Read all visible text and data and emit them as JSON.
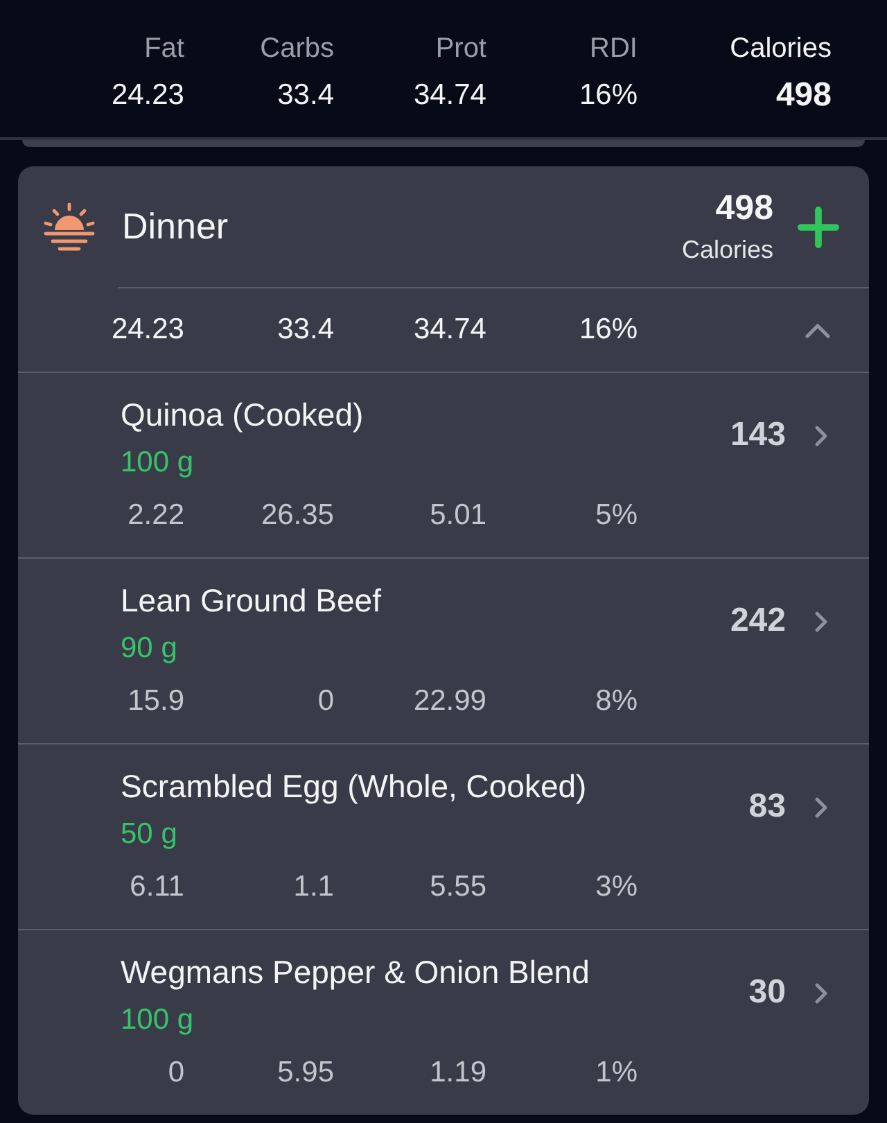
{
  "summary": {
    "columns": [
      {
        "label": "Fat",
        "value": "24.23",
        "kind": "macro"
      },
      {
        "label": "Carbs",
        "value": "33.4",
        "kind": "macro"
      },
      {
        "label": "Prot",
        "value": "34.74",
        "kind": "macro"
      },
      {
        "label": "RDI",
        "value": "16%",
        "kind": "macro"
      },
      {
        "label": "Calories",
        "value": "498",
        "kind": "calories"
      }
    ]
  },
  "meal": {
    "name": "Dinner",
    "calories": "498",
    "calories_label": "Calories",
    "expanded": true,
    "totals": [
      "24.23",
      "33.4",
      "34.74",
      "16%"
    ],
    "foods": [
      {
        "name": "Quinoa (Cooked)",
        "amount": "100 g",
        "calories": "143",
        "macros": [
          "2.22",
          "26.35",
          "5.01",
          "5%"
        ]
      },
      {
        "name": "Lean Ground Beef",
        "amount": "90 g",
        "calories": "242",
        "macros": [
          "15.9",
          "0",
          "22.99",
          "8%"
        ]
      },
      {
        "name": "Scrambled Egg (Whole, Cooked)",
        "amount": "50 g",
        "calories": "83",
        "macros": [
          "6.11",
          "1.1",
          "5.55",
          "3%"
        ]
      },
      {
        "name": "Wegmans Pepper & Onion Blend",
        "amount": "100 g",
        "calories": "30",
        "macros": [
          "0",
          "5.95",
          "1.19",
          "1%"
        ]
      }
    ]
  }
}
